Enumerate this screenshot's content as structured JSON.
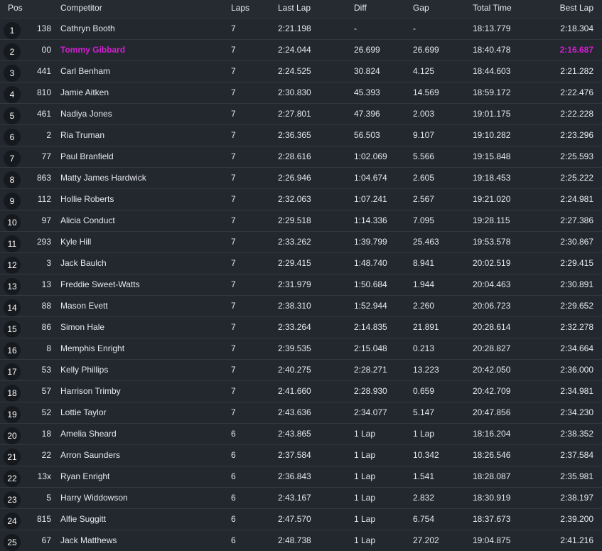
{
  "colors": {
    "background": "#23272e",
    "row_divider": "#33383f",
    "badge": "#16191d",
    "highlight": "#d21fd2",
    "text": "#e6e8eb"
  },
  "header": {
    "pos": "Pos",
    "competitor": "Competitor",
    "laps": "Laps",
    "last_lap": "Last Lap",
    "diff": "Diff",
    "gap": "Gap",
    "total_time": "Total Time",
    "best_lap": "Best Lap"
  },
  "rows": [
    {
      "pos": "1",
      "num": "138",
      "name": "Cathryn Booth",
      "laps": "7",
      "last_lap": "2:21.198",
      "diff": "-",
      "gap": "-",
      "total": "18:13.779",
      "best": "2:18.304",
      "highlight": false
    },
    {
      "pos": "2",
      "num": "00",
      "name": "Tommy Gibbard",
      "laps": "7",
      "last_lap": "2:24.044",
      "diff": "26.699",
      "gap": "26.699",
      "total": "18:40.478",
      "best": "2:16.687",
      "highlight": true
    },
    {
      "pos": "3",
      "num": "441",
      "name": "Carl Benham",
      "laps": "7",
      "last_lap": "2:24.525",
      "diff": "30.824",
      "gap": "4.125",
      "total": "18:44.603",
      "best": "2:21.282",
      "highlight": false
    },
    {
      "pos": "4",
      "num": "810",
      "name": "Jamie Aitken",
      "laps": "7",
      "last_lap": "2:30.830",
      "diff": "45.393",
      "gap": "14.569",
      "total": "18:59.172",
      "best": "2:22.476",
      "highlight": false
    },
    {
      "pos": "5",
      "num": "461",
      "name": "Nadiya Jones",
      "laps": "7",
      "last_lap": "2:27.801",
      "diff": "47.396",
      "gap": "2.003",
      "total": "19:01.175",
      "best": "2:22.228",
      "highlight": false
    },
    {
      "pos": "6",
      "num": "2",
      "name": "Ria Truman",
      "laps": "7",
      "last_lap": "2:36.365",
      "diff": "56.503",
      "gap": "9.107",
      "total": "19:10.282",
      "best": "2:23.296",
      "highlight": false
    },
    {
      "pos": "7",
      "num": "77",
      "name": "Paul Branfield",
      "laps": "7",
      "last_lap": "2:28.616",
      "diff": "1:02.069",
      "gap": "5.566",
      "total": "19:15.848",
      "best": "2:25.593",
      "highlight": false
    },
    {
      "pos": "8",
      "num": "863",
      "name": "Matty James Hardwick",
      "laps": "7",
      "last_lap": "2:26.946",
      "diff": "1:04.674",
      "gap": "2.605",
      "total": "19:18.453",
      "best": "2:25.222",
      "highlight": false
    },
    {
      "pos": "9",
      "num": "112",
      "name": "Hollie Roberts",
      "laps": "7",
      "last_lap": "2:32.063",
      "diff": "1:07.241",
      "gap": "2.567",
      "total": "19:21.020",
      "best": "2:24.981",
      "highlight": false
    },
    {
      "pos": "10",
      "num": "97",
      "name": "Alicia Conduct",
      "laps": "7",
      "last_lap": "2:29.518",
      "diff": "1:14.336",
      "gap": "7.095",
      "total": "19:28.115",
      "best": "2:27.386",
      "highlight": false
    },
    {
      "pos": "11",
      "num": "293",
      "name": "Kyle Hill",
      "laps": "7",
      "last_lap": "2:33.262",
      "diff": "1:39.799",
      "gap": "25.463",
      "total": "19:53.578",
      "best": "2:30.867",
      "highlight": false
    },
    {
      "pos": "12",
      "num": "3",
      "name": "Jack Baulch",
      "laps": "7",
      "last_lap": "2:29.415",
      "diff": "1:48.740",
      "gap": "8.941",
      "total": "20:02.519",
      "best": "2:29.415",
      "highlight": false
    },
    {
      "pos": "13",
      "num": "13",
      "name": "Freddie Sweet-Watts",
      "laps": "7",
      "last_lap": "2:31.979",
      "diff": "1:50.684",
      "gap": "1.944",
      "total": "20:04.463",
      "best": "2:30.891",
      "highlight": false
    },
    {
      "pos": "14",
      "num": "88",
      "name": "Mason Evett",
      "laps": "7",
      "last_lap": "2:38.310",
      "diff": "1:52.944",
      "gap": "2.260",
      "total": "20:06.723",
      "best": "2:29.652",
      "highlight": false
    },
    {
      "pos": "15",
      "num": "86",
      "name": "Simon Hale",
      "laps": "7",
      "last_lap": "2:33.264",
      "diff": "2:14.835",
      "gap": "21.891",
      "total": "20:28.614",
      "best": "2:32.278",
      "highlight": false
    },
    {
      "pos": "16",
      "num": "8",
      "name": "Memphis Enright",
      "laps": "7",
      "last_lap": "2:39.535",
      "diff": "2:15.048",
      "gap": "0.213",
      "total": "20:28.827",
      "best": "2:34.664",
      "highlight": false
    },
    {
      "pos": "17",
      "num": "53",
      "name": "Kelly Phillips",
      "laps": "7",
      "last_lap": "2:40.275",
      "diff": "2:28.271",
      "gap": "13.223",
      "total": "20:42.050",
      "best": "2:36.000",
      "highlight": false
    },
    {
      "pos": "18",
      "num": "57",
      "name": "Harrison Trimby",
      "laps": "7",
      "last_lap": "2:41.660",
      "diff": "2:28.930",
      "gap": "0.659",
      "total": "20:42.709",
      "best": "2:34.981",
      "highlight": false
    },
    {
      "pos": "19",
      "num": "52",
      "name": "Lottie Taylor",
      "laps": "7",
      "last_lap": "2:43.636",
      "diff": "2:34.077",
      "gap": "5.147",
      "total": "20:47.856",
      "best": "2:34.230",
      "highlight": false
    },
    {
      "pos": "20",
      "num": "18",
      "name": "Amelia Sheard",
      "laps": "6",
      "last_lap": "2:43.865",
      "diff": "1 Lap",
      "gap": "1 Lap",
      "total": "18:16.204",
      "best": "2:38.352",
      "highlight": false
    },
    {
      "pos": "21",
      "num": "22",
      "name": "Arron Saunders",
      "laps": "6",
      "last_lap": "2:37.584",
      "diff": "1 Lap",
      "gap": "10.342",
      "total": "18:26.546",
      "best": "2:37.584",
      "highlight": false
    },
    {
      "pos": "22",
      "num": "13x",
      "name": "Ryan Enright",
      "laps": "6",
      "last_lap": "2:36.843",
      "diff": "1 Lap",
      "gap": "1.541",
      "total": "18:28.087",
      "best": "2:35.981",
      "highlight": false
    },
    {
      "pos": "23",
      "num": "5",
      "name": "Harry Widdowson",
      "laps": "6",
      "last_lap": "2:43.167",
      "diff": "1 Lap",
      "gap": "2.832",
      "total": "18:30.919",
      "best": "2:38.197",
      "highlight": false
    },
    {
      "pos": "24",
      "num": "815",
      "name": "Alfie Suggitt",
      "laps": "6",
      "last_lap": "2:47.570",
      "diff": "1 Lap",
      "gap": "6.754",
      "total": "18:37.673",
      "best": "2:39.200",
      "highlight": false
    },
    {
      "pos": "25",
      "num": "67",
      "name": "Jack Matthews",
      "laps": "6",
      "last_lap": "2:48.738",
      "diff": "1 Lap",
      "gap": "27.202",
      "total": "19:04.875",
      "best": "2:41.216",
      "highlight": false
    }
  ]
}
